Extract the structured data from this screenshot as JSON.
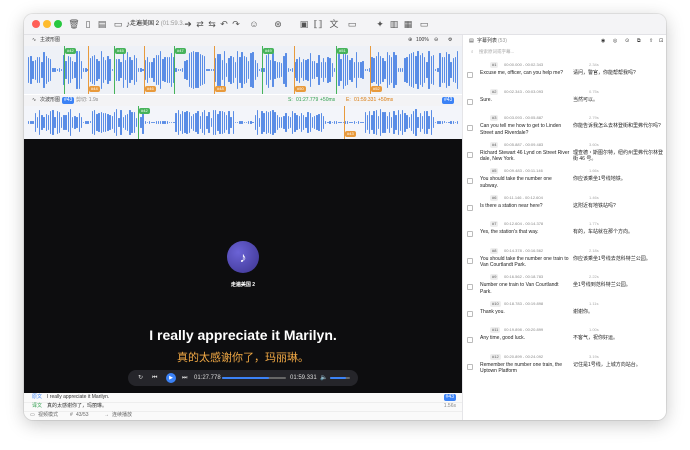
{
  "window": {
    "title": "走遍美国 2",
    "title_meta": "(01:59.3...",
    "dot_colors": [
      "#ff5f57",
      "#febc2e",
      "#28c840"
    ],
    "accent": "#3b82f6"
  },
  "waves": {
    "main": {
      "label": "主波形图",
      "zoom": "100%"
    },
    "second": {
      "label": "次波形图",
      "badge": "#43",
      "speed_label": "剪切: 1.9s",
      "start": "01:27.779",
      "start_offset": "+50ms",
      "end": "01:59.331",
      "end_offset": "+50ms",
      "tag": "#43"
    },
    "main_segments": [
      "#42",
      "#44",
      "#45",
      "#46",
      "#47",
      "#48",
      "#49",
      "#50",
      "#51",
      "#52"
    ],
    "second_segments": [
      "#42",
      "#43"
    ]
  },
  "player": {
    "song_title": "走遍美国 2",
    "subtitle_en": "I really appreciate it Marilyn.",
    "subtitle_zh": "真的太感谢你了，玛丽琳。",
    "current_time": "01:27.778",
    "total_time": "01:59.331",
    "progress": 0.74,
    "volume": 0.8
  },
  "editor": {
    "original_label": "原文",
    "original_text": "I really appreciate it Marilyn.",
    "original_tag": "#43",
    "translation_label": "译文",
    "translation_text": "真的太感谢你了，玛丽琳。",
    "translation_dur": "1.56s"
  },
  "status": {
    "mode": "视频模式",
    "count": "43/53",
    "loop": "连续播放"
  },
  "subtitle_list": {
    "title": "字幕列表",
    "count": "(53)",
    "search_placeholder": "搜索原词或字幕...",
    "items": [
      {
        "num": "#1",
        "time": "00:00.000 - 00:02.343",
        "dur": "2.34s",
        "en": "Excuse me, officer, can you help me?",
        "zh": "请问，警官，你能帮帮我吗?"
      },
      {
        "num": "#2",
        "time": "00:02.343 - 00:03.093",
        "dur": "0.75s",
        "en": "Sure.",
        "zh": "当然可以。"
      },
      {
        "num": "#3",
        "time": "00:03.093 - 00:05.887",
        "dur": "2.79s",
        "en": "Can you tell me how to get to Linden Street and Riverdale?",
        "zh": "你能告诉我怎么去林登街和里弗代尔吗?"
      },
      {
        "num": "#4",
        "time": "00:05.887 - 00:09.483",
        "dur": "3.60s",
        "en": "Richard Stewart 46 Lynd on Street River dale, New York.",
        "zh": "理查德・斯图尔特，纽约州里弗代尔林登街 46 号。"
      },
      {
        "num": "#5",
        "time": "00:09.483 - 00:11.146",
        "dur": "1.66s",
        "en": "You should take the number one subway.",
        "zh": "你应该乘坐1号线地铁。"
      },
      {
        "num": "#6",
        "time": "00:11.146 - 00:12.604",
        "dur": "1.46s",
        "en": "Is there a station near here?",
        "zh": "这附近有地铁站吗?"
      },
      {
        "num": "#7",
        "time": "00:12.604 - 00:14.378",
        "dur": "1.77s",
        "en": "Yes, the station's that way.",
        "zh": "有的，车站就在那个方向。"
      },
      {
        "num": "#8",
        "time": "00:14.378 - 00:16.562",
        "dur": "2.18s",
        "en": "You should take the number one train to Van Courtlandt Park.",
        "zh": "你应该乘坐1号线去范科特兰公园。"
      },
      {
        "num": "#9",
        "time": "00:16.562 - 00:18.783",
        "dur": "2.22s",
        "en": "Number one train to Van Courtlandt Park.",
        "zh": "坐1号线到范科特兰公园。"
      },
      {
        "num": "#10",
        "time": "00:18.783 - 00:19.898",
        "dur": "1.11s",
        "en": "Thank you.",
        "zh": "谢谢你。"
      },
      {
        "num": "#11",
        "time": "00:19.898 - 00:20.899",
        "dur": "1.00s",
        "en": "Any time, good luck.",
        "zh": "不客气，祝你好运。"
      },
      {
        "num": "#12",
        "time": "00:20.899 - 00:24.092",
        "dur": "3.19s",
        "en": "Remember the number one train, the Uptown Platform",
        "zh": "记住是1号线，上城方向站台。"
      }
    ]
  }
}
